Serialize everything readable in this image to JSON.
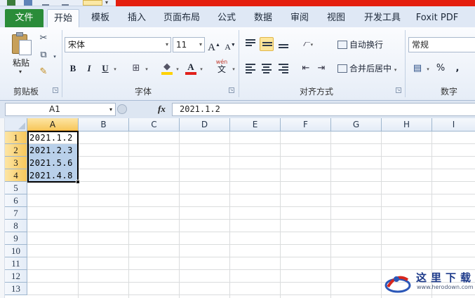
{
  "ribbon_tabs": {
    "file": "文件",
    "items": [
      "开始",
      "模板",
      "插入",
      "页面布局",
      "公式",
      "数据",
      "审阅",
      "视图",
      "开发工具",
      "Foxit PDF"
    ],
    "active_index": 0
  },
  "clipboard_group": {
    "paste_label": "粘贴",
    "group_label": "剪贴板"
  },
  "font_group": {
    "font_name": "宋体",
    "font_size": "11",
    "bold": "B",
    "italic": "I",
    "underline": "U",
    "font_color_letter": "A",
    "phonetic": "wén",
    "phonetic_char": "文",
    "grow_font": "A",
    "shrink_font": "A",
    "group_label": "字体",
    "highlight_color": "#ffd200",
    "font_color": "#e0201b"
  },
  "alignment_group": {
    "wrap_text": "自动换行",
    "merge_center": "合并后居中",
    "group_label": "对齐方式"
  },
  "number_group": {
    "format": "常规",
    "percent": "%",
    "comma": ",",
    "group_label": "数字"
  },
  "formula_bar": {
    "name_box": "A1",
    "fx": "fx",
    "content": "2021.1.2"
  },
  "sheet": {
    "columns": [
      "A",
      "B",
      "C",
      "D",
      "E",
      "F",
      "G",
      "H",
      "I"
    ],
    "selected_column": "A",
    "rows": [
      "1",
      "2",
      "3",
      "4",
      "5",
      "6",
      "7",
      "8",
      "9",
      "10",
      "11",
      "12",
      "13"
    ],
    "selected_rows": [
      "1",
      "2",
      "3",
      "4"
    ],
    "cells_A": [
      "2021.1.2",
      "2021.2.3",
      "2021.5.6",
      "2021.4.8"
    ],
    "active_cell": "A1"
  },
  "watermark": {
    "brand": "这里下载",
    "url": "www.herodown.com"
  }
}
